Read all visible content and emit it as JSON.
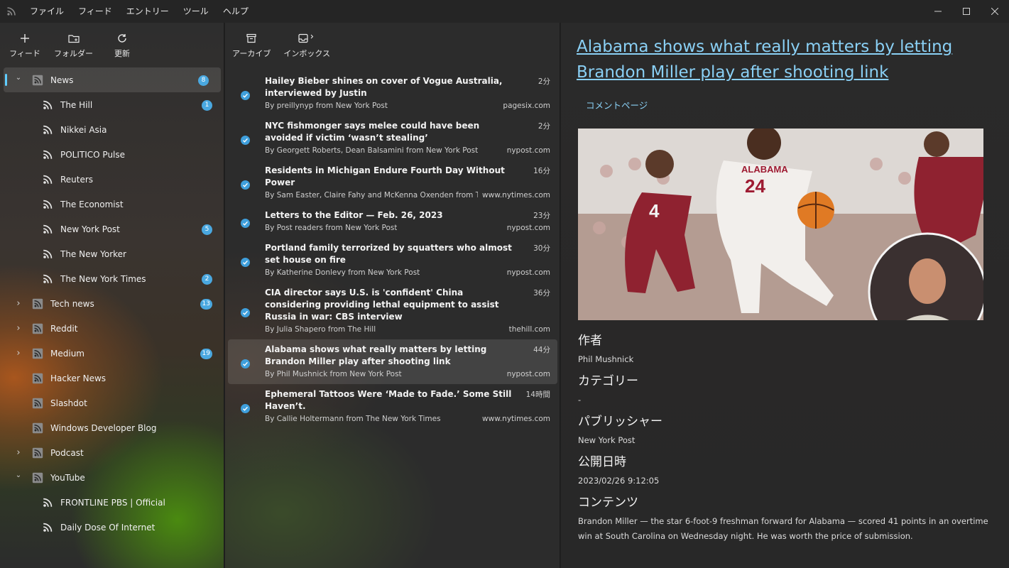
{
  "menu": [
    "ファイル",
    "フィード",
    "エントリー",
    "ツール",
    "ヘルプ"
  ],
  "window_controls": [
    "minimize-icon",
    "maximize-icon",
    "close-icon"
  ],
  "feeds_toolbar": [
    {
      "label": "フィード",
      "icon": "plus-icon"
    },
    {
      "label": "フォルダー",
      "icon": "folder-add-icon"
    },
    {
      "label": "更新",
      "icon": "refresh-icon"
    }
  ],
  "entries_toolbar": [
    {
      "label": "アーカイブ",
      "icon": "archive-icon"
    },
    {
      "label": "インボックス",
      "icon": "inbox-icon"
    }
  ],
  "tree": [
    {
      "label": "News",
      "level": 0,
      "chevron": "down",
      "badge": "8",
      "selected": true
    },
    {
      "label": "The Hill",
      "level": 1,
      "badge": "1"
    },
    {
      "label": "Nikkei Asia",
      "level": 1,
      "badge": ""
    },
    {
      "label": "POLITICO Pulse",
      "level": 1,
      "badge": ""
    },
    {
      "label": "Reuters",
      "level": 1,
      "badge": ""
    },
    {
      "label": "The Economist",
      "level": 1,
      "badge": ""
    },
    {
      "label": "New York Post",
      "level": 1,
      "badge": "5"
    },
    {
      "label": "The New Yorker",
      "level": 1,
      "badge": ""
    },
    {
      "label": "The New York Times",
      "level": 1,
      "badge": "2"
    },
    {
      "label": "Tech news",
      "level": 0,
      "chevron": "right",
      "badge": "13"
    },
    {
      "label": "Reddit",
      "level": 0,
      "chevron": "right",
      "badge": ""
    },
    {
      "label": "Medium",
      "level": 0,
      "chevron": "right",
      "badge": "19"
    },
    {
      "label": "Hacker News",
      "level": 0,
      "chevron": "",
      "badge": ""
    },
    {
      "label": "Slashdot",
      "level": 0,
      "chevron": "",
      "badge": ""
    },
    {
      "label": "Windows Developer Blog",
      "level": 0,
      "chevron": "",
      "badge": ""
    },
    {
      "label": "Podcast",
      "level": 0,
      "chevron": "right",
      "badge": ""
    },
    {
      "label": "YouTube",
      "level": 0,
      "chevron": "down",
      "badge": ""
    },
    {
      "label": "FRONTLINE PBS | Official",
      "level": 1,
      "badge": ""
    },
    {
      "label": "Daily Dose Of Internet",
      "level": 1,
      "badge": ""
    }
  ],
  "entries": [
    {
      "title": "Hailey Bieber shines on cover of Vogue Australia, interviewed by Justin",
      "time": "2分",
      "byline": "By preillynyp from New York Post",
      "domain": "pagesix.com",
      "selected": false
    },
    {
      "title": "NYC fishmonger says melee could have been avoided if victim ‘wasn’t stealing’",
      "time": "2分",
      "byline": "By Georgett Roberts, Dean Balsamini from New York Post",
      "domain": "nypost.com",
      "selected": false
    },
    {
      "title": "Residents in Michigan Endure Fourth Day Without Power",
      "time": "16分",
      "byline": "By Sam Easter, Claire Fahy and McKenna Oxenden from The...",
      "domain": "www.nytimes.com",
      "selected": false
    },
    {
      "title": "Letters to the Editor — Feb. 26, 2023",
      "time": "23分",
      "byline": "By Post readers from New York Post",
      "domain": "nypost.com",
      "selected": false
    },
    {
      "title": "Portland family terrorized by squatters who almost set house on fire",
      "time": "30分",
      "byline": "By Katherine Donlevy from New York Post",
      "domain": "nypost.com",
      "selected": false
    },
    {
      "title": "CIA director says U.S. is 'confident' China considering providing lethal equipment to assist Russia in war: CBS interview",
      "time": "36分",
      "byline": "By Julia Shapero from The Hill",
      "domain": "thehill.com",
      "selected": false
    },
    {
      "title": "Alabama shows what really matters by letting Brandon Miller play after shooting link",
      "time": "44分",
      "byline": "By Phil Mushnick from New York Post",
      "domain": "nypost.com",
      "selected": true
    },
    {
      "title": "Ephemeral Tattoos Were ‘Made to Fade.’ Some Still Haven’t.",
      "time": "14時間",
      "byline": "By Callie Holtermann from The New York Times",
      "domain": "www.nytimes.com",
      "selected": false
    }
  ],
  "article": {
    "title": "Alabama shows what really matters by letting Brandon Miller play after shooting link",
    "comment_link": "コメントページ",
    "image": {
      "jersey_main": "24",
      "team_main": "ALABAMA",
      "jersey_left": "4"
    },
    "author_label": "作者",
    "author": "Phil Mushnick",
    "category_label": "カテゴリー",
    "category": "-",
    "publisher_label": "パブリッシャー",
    "publisher": "New York Post",
    "published_label": "公開日時",
    "published": "2023/02/26 9:12:05",
    "content_label": "コンテンツ",
    "content": "Brandon Miller — the star 6-foot-9 freshman forward for Alabama — scored 41 points in an overtime win at South Carolina on Wednesday night. He was worth the price of submission."
  }
}
